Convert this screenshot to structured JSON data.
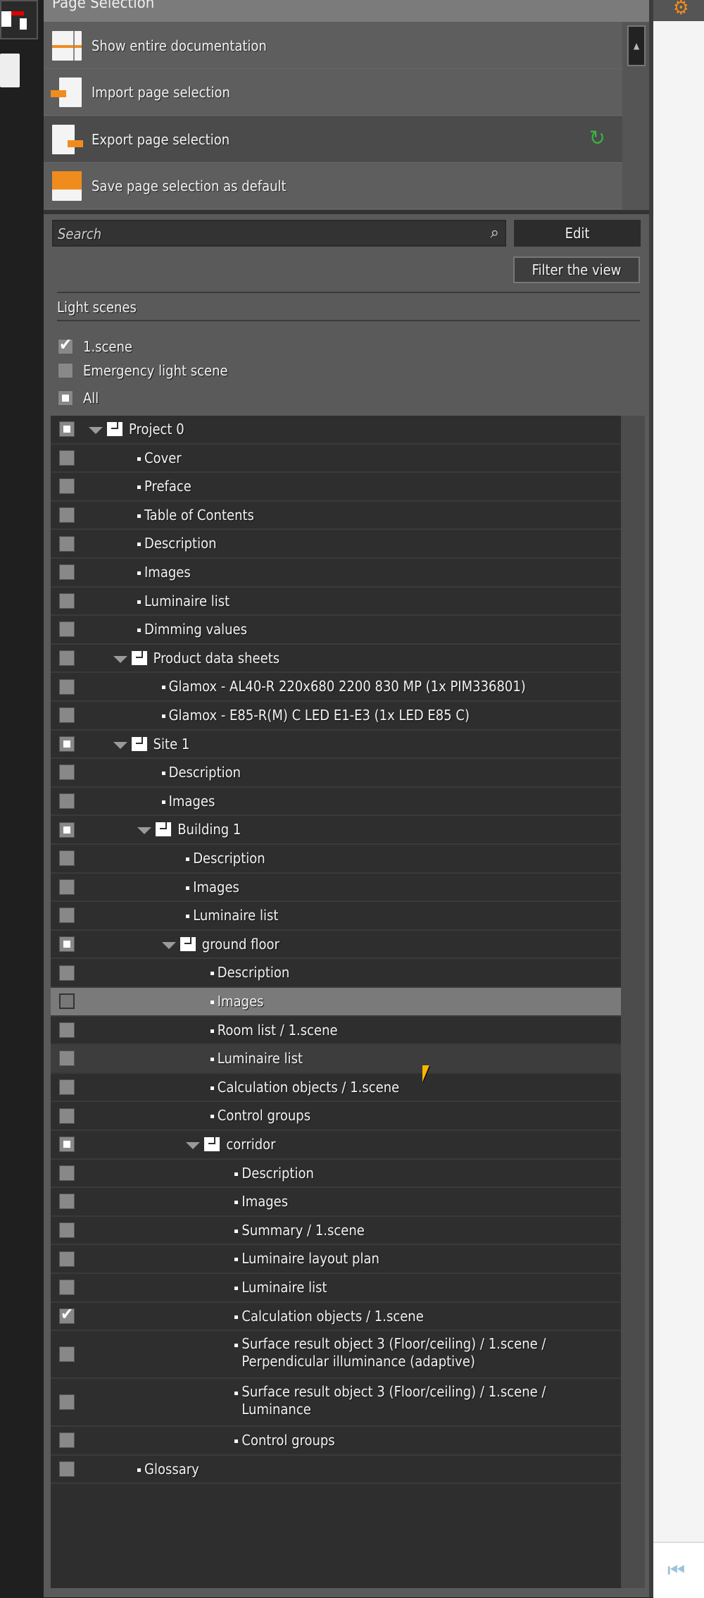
{
  "header": {
    "title": "Page Selection"
  },
  "actions": [
    {
      "label": "Show entire documentation",
      "icon": "document-columns-icon"
    },
    {
      "label": "Import page selection",
      "icon": "import-icon"
    },
    {
      "label": "Export page selection",
      "icon": "export-icon"
    },
    {
      "label": "Save page selection as default",
      "icon": "save-icon"
    }
  ],
  "search": {
    "placeholder": "Search",
    "edit_label": "Edit",
    "filter_label": "Filter the view"
  },
  "light_scenes": {
    "title": "Light scenes",
    "items": [
      {
        "label": "1.scene",
        "state": "checked"
      },
      {
        "label": "Emergency light scene",
        "state": "unchecked"
      },
      {
        "label": "All",
        "state": "partial"
      }
    ]
  },
  "colors": {
    "accent": "#f08c1e",
    "refresh": "#3cb043",
    "selected_row": "#7a7a7a",
    "tree_bg": "#2e2e2e"
  },
  "tree": [
    {
      "label": "Project 0",
      "type": "folder",
      "level": 0,
      "check": "partial"
    },
    {
      "label": "Cover",
      "type": "leaf",
      "level": 1,
      "check": "none"
    },
    {
      "label": "Preface",
      "type": "leaf",
      "level": 1,
      "check": "none"
    },
    {
      "label": "Table of Contents",
      "type": "leaf",
      "level": 1,
      "check": "none"
    },
    {
      "label": "Description",
      "type": "leaf",
      "level": 1,
      "check": "none"
    },
    {
      "label": "Images",
      "type": "leaf",
      "level": 1,
      "check": "none"
    },
    {
      "label": "Luminaire list",
      "type": "leaf",
      "level": 1,
      "check": "none"
    },
    {
      "label": "Dimming values",
      "type": "leaf",
      "level": 1,
      "check": "none"
    },
    {
      "label": "Product data sheets",
      "type": "folder",
      "level": 1,
      "check": "none"
    },
    {
      "label": "Glamox - AL40-R 220x680 2200 830 MP (1x PIM336801)",
      "type": "leaf",
      "level": 2,
      "check": "none"
    },
    {
      "label": "Glamox - E85-R(M) C LED E1-E3 (1x LED E85 C)",
      "type": "leaf",
      "level": 2,
      "check": "none"
    },
    {
      "label": "Site 1",
      "type": "folder",
      "level": 1,
      "check": "partial"
    },
    {
      "label": "Description",
      "type": "leaf",
      "level": 2,
      "check": "none"
    },
    {
      "label": "Images",
      "type": "leaf",
      "level": 2,
      "check": "none"
    },
    {
      "label": "Building 1",
      "type": "folder",
      "level": 2,
      "check": "partial"
    },
    {
      "label": "Description",
      "type": "leaf",
      "level": 3,
      "check": "none"
    },
    {
      "label": "Images",
      "type": "leaf",
      "level": 3,
      "check": "none"
    },
    {
      "label": "Luminaire list",
      "type": "leaf",
      "level": 3,
      "check": "none"
    },
    {
      "label": "ground floor",
      "type": "folder",
      "level": 3,
      "check": "partial"
    },
    {
      "label": "Description",
      "type": "leaf",
      "level": 4,
      "check": "none"
    },
    {
      "label": "Images",
      "type": "leaf",
      "level": 4,
      "check": "none",
      "state": "selected"
    },
    {
      "label": "Room list / 1.scene",
      "type": "leaf",
      "level": 4,
      "check": "none"
    },
    {
      "label": "Luminaire list",
      "type": "leaf",
      "level": 4,
      "check": "none",
      "state": "hover"
    },
    {
      "label": "Calculation objects / 1.scene",
      "type": "leaf",
      "level": 4,
      "check": "none"
    },
    {
      "label": "Control groups",
      "type": "leaf",
      "level": 4,
      "check": "none"
    },
    {
      "label": "corridor",
      "type": "folder",
      "level": 4,
      "check": "partial"
    },
    {
      "label": "Description",
      "type": "leaf",
      "level": 5,
      "check": "none"
    },
    {
      "label": "Images",
      "type": "leaf",
      "level": 5,
      "check": "none"
    },
    {
      "label": "Summary / 1.scene",
      "type": "leaf",
      "level": 5,
      "check": "none"
    },
    {
      "label": "Luminaire layout plan",
      "type": "leaf",
      "level": 5,
      "check": "none"
    },
    {
      "label": "Luminaire list",
      "type": "leaf",
      "level": 5,
      "check": "none"
    },
    {
      "label": "Calculation objects / 1.scene",
      "type": "leaf",
      "level": 5,
      "check": "checked"
    },
    {
      "label": "Surface result object 3 (Floor/ceiling) / 1.scene / Perpendicular illuminance (adaptive)",
      "type": "leaf",
      "level": 5,
      "check": "none"
    },
    {
      "label": "Surface result object 3 (Floor/ceiling) / 1.scene / Luminance",
      "type": "leaf",
      "level": 5,
      "check": "none"
    },
    {
      "label": "Control groups",
      "type": "leaf",
      "level": 5,
      "check": "none"
    },
    {
      "label": "Glossary",
      "type": "leaf",
      "level": 1,
      "check": "none"
    }
  ]
}
